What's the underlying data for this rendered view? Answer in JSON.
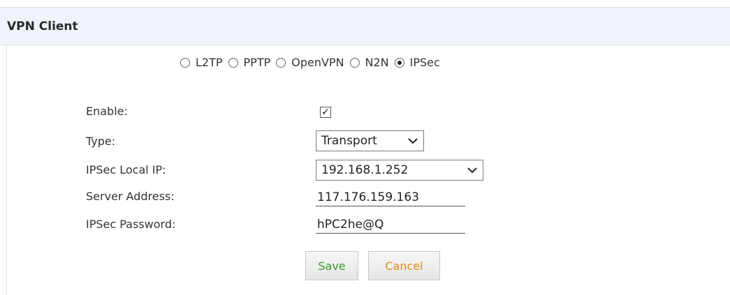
{
  "panel": {
    "title": "VPN Client"
  },
  "vpn_types": [
    {
      "label": "L2TP",
      "checked": false
    },
    {
      "label": "PPTP",
      "checked": false
    },
    {
      "label": "OpenVPN",
      "checked": false
    },
    {
      "label": "N2N",
      "checked": false
    },
    {
      "label": "IPSec",
      "checked": true
    }
  ],
  "form": {
    "enable_label": "Enable:",
    "enable_checked": true,
    "enable_mark": "✓",
    "type_label": "Type:",
    "type_value": "Transport",
    "local_ip_label": "IPSec Local IP:",
    "local_ip_value": "192.168.1.252",
    "server_label": "Server Address:",
    "server_value": "117.176.159.163",
    "password_label": "IPSec Password:",
    "password_value": "hPC2he@Q"
  },
  "buttons": {
    "save_label": "Save",
    "cancel_label": "Cancel"
  },
  "icons": {
    "select_chevron": "chevron-down-icon"
  },
  "colors": {
    "header_bg": "#eef4f9",
    "save_text": "#3a9a2a",
    "cancel_text": "#e58a1a"
  }
}
